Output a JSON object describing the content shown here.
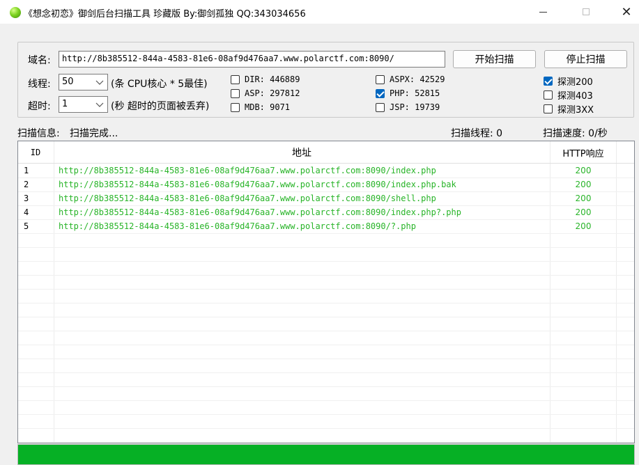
{
  "window": {
    "title": "《想念初恋》御剑后台扫描工具 珍藏版 By:御剑孤独 QQ:343034656",
    "icon": "green-orb-icon",
    "close_glyph": "✕"
  },
  "form": {
    "domain_label": "域名:",
    "domain_value": "http://8b385512-844a-4583-81e6-08af9d476aa7.www.polarctf.com:8090/",
    "start_button": "开始扫描",
    "stop_button": "停止扫描",
    "threads_label": "线程:",
    "threads_value": "50",
    "threads_hint": "(条 CPU核心 * 5最佳)",
    "timeout_label": "超时:",
    "timeout_value": "1",
    "timeout_hint": "(秒 超时的页面被丢弃)"
  },
  "dictionaries": [
    {
      "label": "DIR: 446889",
      "checked": false
    },
    {
      "label": "ASP: 297812",
      "checked": false
    },
    {
      "label": "MDB: 9071",
      "checked": false
    },
    {
      "label": "ASPX: 42529",
      "checked": false
    },
    {
      "label": "PHP: 52815",
      "checked": true
    },
    {
      "label": "JSP: 19739",
      "checked": false
    }
  ],
  "detect": [
    {
      "label": "探测200",
      "checked": true
    },
    {
      "label": "探测403",
      "checked": false
    },
    {
      "label": "探测3XX",
      "checked": false
    }
  ],
  "status": {
    "info_label": "扫描信息:",
    "info_value": "扫描完成...",
    "threads_text": "扫描线程: 0",
    "speed_text": "扫描速度: 0/秒"
  },
  "table": {
    "columns": [
      "ID",
      "地址",
      "HTTP响应"
    ],
    "rows": [
      {
        "id": "1",
        "url": "http://8b385512-844a-4583-81e6-08af9d476aa7.www.polarctf.com:8090/index.php",
        "code": "200"
      },
      {
        "id": "2",
        "url": "http://8b385512-844a-4583-81e6-08af9d476aa7.www.polarctf.com:8090/index.php.bak",
        "code": "200"
      },
      {
        "id": "3",
        "url": "http://8b385512-844a-4583-81e6-08af9d476aa7.www.polarctf.com:8090/shell.php",
        "code": "200"
      },
      {
        "id": "4",
        "url": "http://8b385512-844a-4583-81e6-08af9d476aa7.www.polarctf.com:8090/index.php?.php",
        "code": "200"
      },
      {
        "id": "5",
        "url": "http://8b385512-844a-4583-81e6-08af9d476aa7.www.polarctf.com:8090/?.php",
        "code": "200"
      }
    ]
  },
  "progress": {
    "fraction": 1.0,
    "color": "#06b025"
  },
  "colors": {
    "result_text": "#28b428",
    "checkbox_checked": "#0067c0"
  }
}
